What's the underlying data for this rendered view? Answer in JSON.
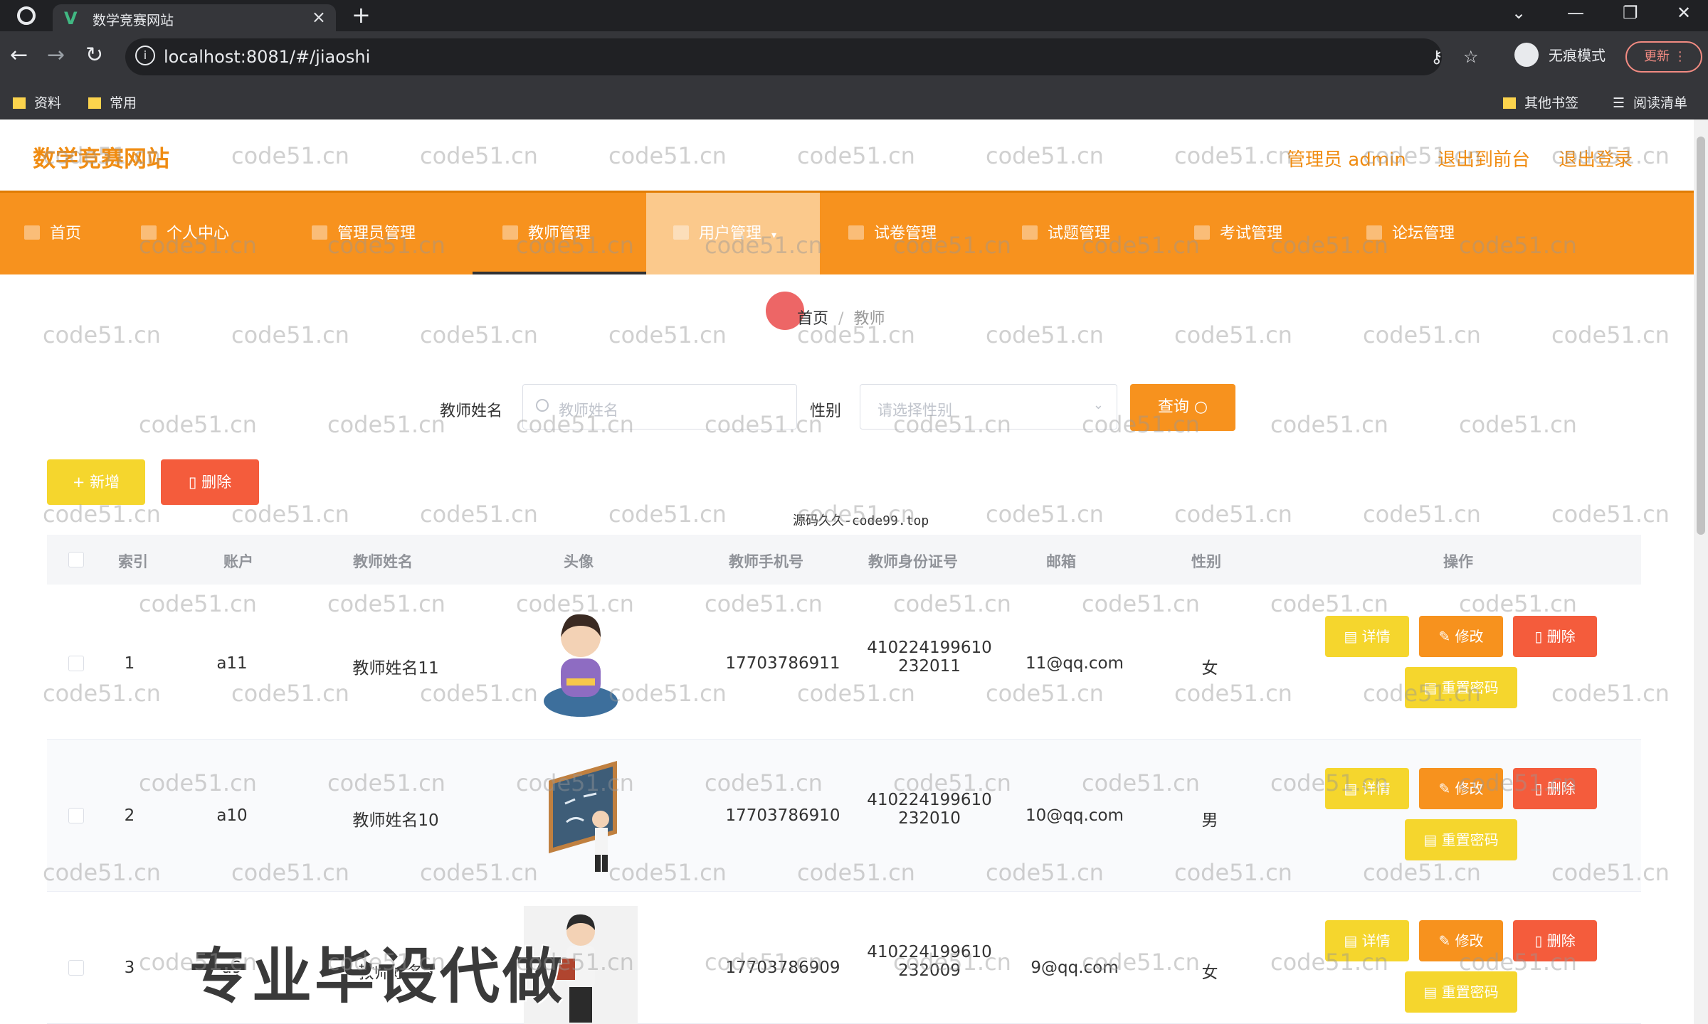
{
  "browser": {
    "tab_title": "数学竞赛网站",
    "tab_favicon": "V",
    "url": "localhost:8081/#/jiaoshi",
    "incognito_label": "无痕模式",
    "update_label": "更新",
    "bookmarks": [
      "资料",
      "常用"
    ],
    "bookmarks_right": [
      "其他书签",
      "阅读清单"
    ]
  },
  "header": {
    "site_title": "数学竞赛网站",
    "admin_label": "管理员 admin",
    "backend_link": "退出到前台",
    "logout_link": "退出登录"
  },
  "nav": {
    "items": [
      {
        "label": "首页",
        "icon": "home-icon"
      },
      {
        "label": "个人中心",
        "icon": "user-icon"
      },
      {
        "label": "管理员管理",
        "icon": "menu-icon"
      },
      {
        "label": "教师管理",
        "icon": "menu-icon"
      },
      {
        "label": "用户管理",
        "icon": "chart-icon"
      },
      {
        "label": "试卷管理",
        "icon": "menu-icon"
      },
      {
        "label": "试题管理",
        "icon": "menu-icon"
      },
      {
        "label": "考试管理",
        "icon": "menu-icon"
      },
      {
        "label": "论坛管理",
        "icon": "menu-icon"
      }
    ]
  },
  "breadcrumb": {
    "home": "首页",
    "sep": "/",
    "current": "教师"
  },
  "search": {
    "name_label": "教师姓名",
    "name_placeholder": "教师姓名",
    "gender_label": "性别",
    "gender_placeholder": "请选择性别",
    "query_label": "查询"
  },
  "actions": {
    "add_label": "+ 新增",
    "delete_label": "删除"
  },
  "mid_watermark": "源码久久-code99.top",
  "table": {
    "columns": [
      "索引",
      "账户",
      "教师姓名",
      "头像",
      "教师手机号",
      "教师身份证号",
      "邮箱",
      "性别",
      "操作"
    ],
    "rows": [
      {
        "index": "1",
        "account": "a11",
        "name": "教师姓名11",
        "phone": "17703786911",
        "id_line1": "410224199610",
        "id_line2": "232011",
        "email": "11@qq.com",
        "gender": "女"
      },
      {
        "index": "2",
        "account": "a10",
        "name": "教师姓名10",
        "phone": "17703786910",
        "id_line1": "410224199610",
        "id_line2": "232010",
        "email": "10@qq.com",
        "gender": "男"
      },
      {
        "index": "3",
        "account": "a9",
        "name": "教师姓名9",
        "phone": "17703786909",
        "id_line1": "410224199610",
        "id_line2": "232009",
        "email": "9@qq.com",
        "gender": "女"
      }
    ],
    "ops": {
      "detail": "详情",
      "edit": "修改",
      "delete": "删除",
      "reset": "重置密码"
    }
  },
  "watermark_text": "code51.cn",
  "overlay_banner": "专业毕设代做",
  "colors": {
    "accent": "#f7921e",
    "title": "#f08c12",
    "warning": "#f5d62d",
    "danger": "#f45c3c"
  }
}
